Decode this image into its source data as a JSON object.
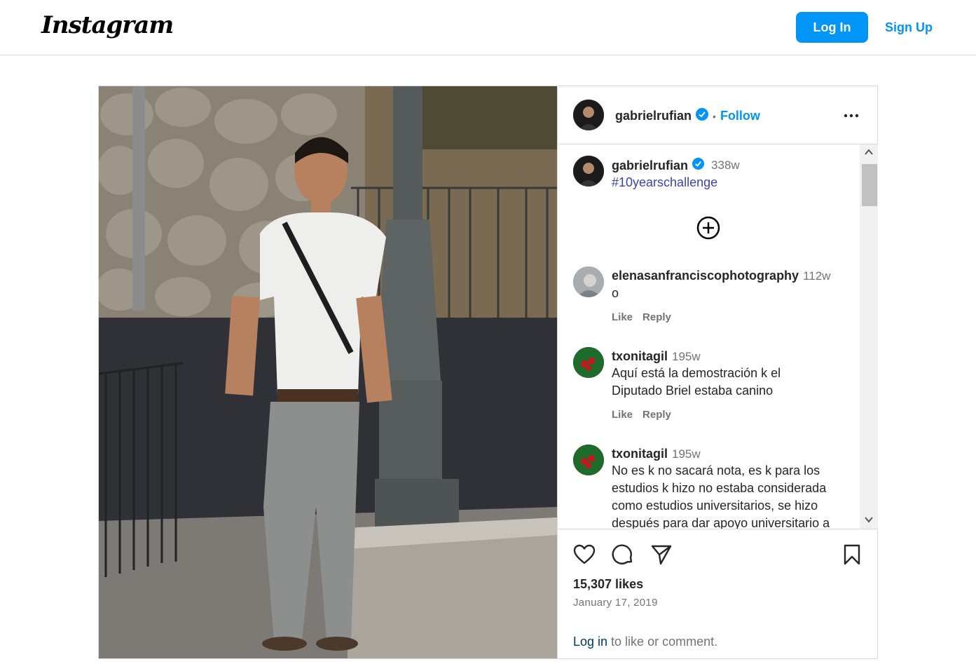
{
  "header": {
    "logo_text": "Instagram",
    "login_label": "Log In",
    "signup_label": "Sign Up"
  },
  "post": {
    "author": "gabrielrufian",
    "follow_label": "Follow",
    "separator": "•",
    "caption": {
      "username": "gabrielrufian",
      "time": "338w",
      "text": "#10yearschallenge"
    },
    "comments": [
      {
        "username": "elenasanfranciscophotography",
        "time": "112w",
        "lines": [
          "o"
        ],
        "like_label": "Like",
        "reply_label": "Reply"
      },
      {
        "username": "txonitagil",
        "time": "195w",
        "lines": [
          "Aquí está la demostración k el",
          "Diputado Briel estaba canino"
        ],
        "like_label": "Like",
        "reply_label": "Reply"
      },
      {
        "username": "txonitagil",
        "time": "195w",
        "lines": [
          "No es k no sacará nota, es k para los",
          "estudios k hizo no estaba considerada",
          "como estudios universitarios, se hizo",
          "después para dar apoyo universitario a"
        ]
      }
    ],
    "likes_text": "15,307 likes",
    "date_text": "January 17, 2019",
    "login_prompt": {
      "link": "Log in",
      "rest": " to like or comment."
    }
  },
  "colors": {
    "accent": "#0095f6",
    "hashtag": "#3943b7",
    "muted": "#737373",
    "border": "#dbdbdb"
  }
}
